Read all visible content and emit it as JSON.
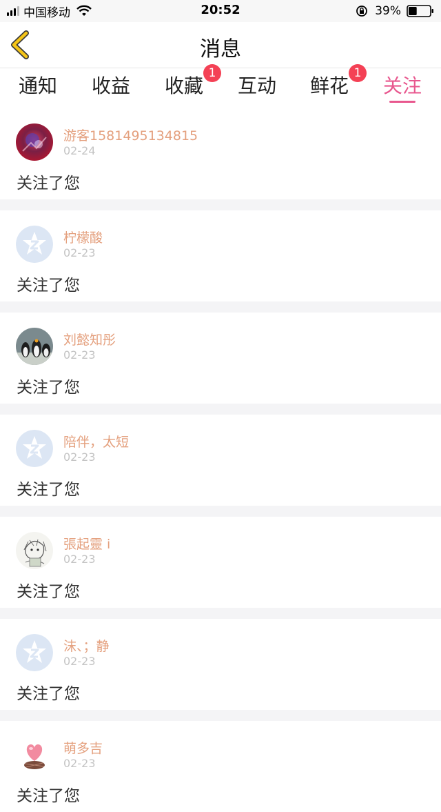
{
  "status_bar": {
    "carrier": "中国移动",
    "time": "20:52",
    "battery_percent": "39%",
    "battery_level": 0.39
  },
  "nav": {
    "title": "消息",
    "back_icon": "chevron-left-icon"
  },
  "tabs": [
    {
      "label": "通知",
      "badge": ""
    },
    {
      "label": "收益",
      "badge": ""
    },
    {
      "label": "收藏",
      "badge": "1"
    },
    {
      "label": "互动",
      "badge": ""
    },
    {
      "label": "鲜花",
      "badge": "1"
    },
    {
      "label": "关注",
      "badge": ""
    }
  ],
  "active_tab": "关注",
  "items": [
    {
      "name": "游客1581495134815",
      "date": "02-24",
      "action": "关注了您",
      "avatar": "photo-red"
    },
    {
      "name": "柠檬酸",
      "date": "02-23",
      "action": "关注了您",
      "avatar": "default"
    },
    {
      "name": "刘懿知彤",
      "date": "02-23",
      "action": "关注了您",
      "avatar": "photo-penguins"
    },
    {
      "name": "陪伴，太短",
      "date": "02-23",
      "action": "关注了您",
      "avatar": "default"
    },
    {
      "name": "張起靈 i",
      "date": "02-23",
      "action": "关注了您",
      "avatar": "photo-sketch"
    },
    {
      "name": "沫、；静",
      "date": "02-23",
      "action": "关注了您",
      "avatar": "default"
    },
    {
      "name": "萌多吉",
      "date": "02-23",
      "action": "关注了您",
      "avatar": "photo-heart"
    }
  ],
  "colors": {
    "accent": "#e8578e",
    "username": "#e4a07e",
    "badge": "#f44155",
    "back_icon": "#f5c518"
  }
}
